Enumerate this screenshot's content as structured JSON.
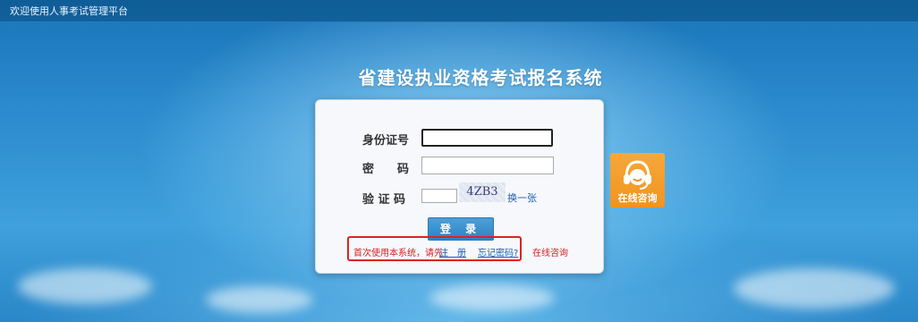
{
  "topbar": {
    "welcome": "欢迎使用人事考试管理平台"
  },
  "page": {
    "title": "省建设执业资格考试报名系统"
  },
  "login": {
    "id_label": "身份证号",
    "password_label": "密　　码",
    "captcha_label": "验 证 码",
    "id_value": "",
    "password_value": "",
    "captcha_value": "",
    "captcha_image_text": "4ZB3",
    "refresh_captcha": "换一张",
    "submit": "登 录"
  },
  "footer": {
    "first_use_text": "首次使用本系统，请先",
    "register": "注　册",
    "forgot_password": "忘记密码?",
    "online_consult": "在线咨询"
  },
  "consult_widget": {
    "label": "在线咨询",
    "icon": "headset-icon"
  },
  "colors": {
    "accent_blue": "#2d84c4",
    "highlight_red": "#e02020",
    "consult_orange": "#f09420"
  }
}
